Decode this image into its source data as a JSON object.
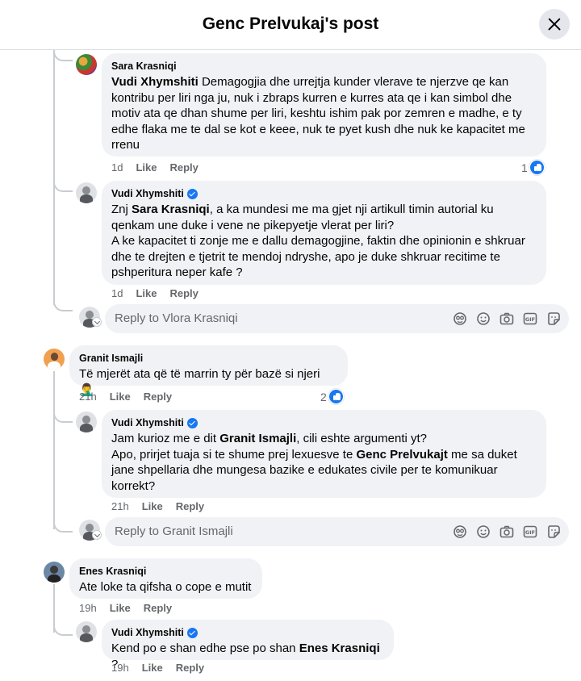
{
  "header": {
    "title": "Genc Prelvukaj's post"
  },
  "comments": [
    {
      "author": "Sara Krasniqi",
      "mention": "Vudi Xhymshiti",
      "text": " Demagogjia dhe urrejtja kunder vlerave te njerzve qe kan kontribu per liri nga ju, nuk i zbraps kurren e kurres ata qe i kan simbol dhe motiv ata qe dhan shume per liri, keshtu ishim pak por zemren e madhe, e ty edhe flaka me te dal se kot e keee, nuk te pyet kush dhe nuk ke kapacitet me rrenu",
      "time": "1d",
      "like": "Like",
      "reply": "Reply",
      "reactions": "1"
    },
    {
      "author": "Vudi Xhymshiti",
      "text_1": "Znj ",
      "mention": "Sara Krasniqi",
      "text_2": ", a ka mundesi me ma gjet nji artikull timin autorial ku qenkam une duke i vene ne pikepyetje vlerat per liri?",
      "text_3": "A ke kapacitet ti zonje me e dallu demagogjine, faktin dhe opinionin e shkruar dhe te drejten e tjetrit te mendoj ndryshe, apo je duke shkruar recitime te pshperitura neper kafe ?",
      "time": "1d",
      "like": "Like",
      "reply": "Reply"
    },
    {
      "author": "Granit Ismajli",
      "text": "Të mjerët ata që të marrin ty për bazë si njeri 🤦‍♂️",
      "time": "21h",
      "like": "Like",
      "reply": "Reply",
      "reactions": "2"
    },
    {
      "author": "Vudi Xhymshiti",
      "text_1": "Jam kurioz me e dit ",
      "mention_1": "Granit Ismajli",
      "text_2": ", cili eshte argumenti yt?",
      "text_3": "Apo, prirjet tuaja si te shume prej lexuesve te ",
      "mention_2": "Genc Prelvukajt",
      "text_4": " me sa duket jane shpellaria dhe mungesa bazike e edukates civile per te komunikuar korrekt?",
      "time": "21h",
      "like": "Like",
      "reply": "Reply"
    },
    {
      "author": "Enes Krasniqi",
      "text": "Ate loke ta qifsha o cope e mutit",
      "time": "19h",
      "like": "Like",
      "reply": "Reply"
    },
    {
      "author": "Vudi Xhymshiti",
      "text_1": "Kend po e shan edhe pse po shan ",
      "mention": "Enes Krasniqi",
      "text_2": " ?",
      "time": "19h",
      "like": "Like",
      "reply": "Reply"
    }
  ],
  "reply_boxes": [
    {
      "placeholder": "Reply to Vlora Krasniqi"
    },
    {
      "placeholder": "Reply to Granit Ismajli"
    }
  ],
  "icons": [
    "avatar-sticker-icon",
    "emoji-icon",
    "camera-icon",
    "gif-icon",
    "sticker-icon"
  ],
  "colors": {
    "accent": "#1877f2",
    "bubble": "#f0f2f5",
    "secondary_text": "#65676b"
  }
}
